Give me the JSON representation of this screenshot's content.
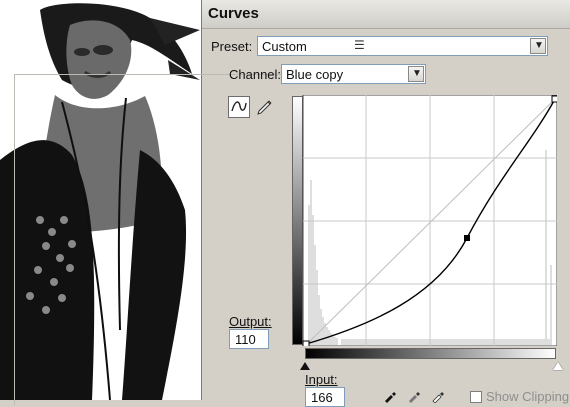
{
  "dialog": {
    "title": "Curves",
    "preset": {
      "label": "Preset:",
      "value": "Custom"
    },
    "channel": {
      "label": "Channel:",
      "value": "Blue copy"
    },
    "output": {
      "label": "Output:",
      "value": "110"
    },
    "input": {
      "label": "Input:",
      "value": "166"
    },
    "show_clipping": {
      "label": "Show Clipping"
    }
  },
  "icons": {
    "curve_tool": "curve-tool-icon",
    "pencil_tool": "pencil-icon",
    "preset_options": "preset-options-icon",
    "black_eyedropper": "eyedropper-black-icon",
    "gray_eyedropper": "eyedropper-gray-icon",
    "white_eyedropper": "eyedropper-white-icon"
  }
}
